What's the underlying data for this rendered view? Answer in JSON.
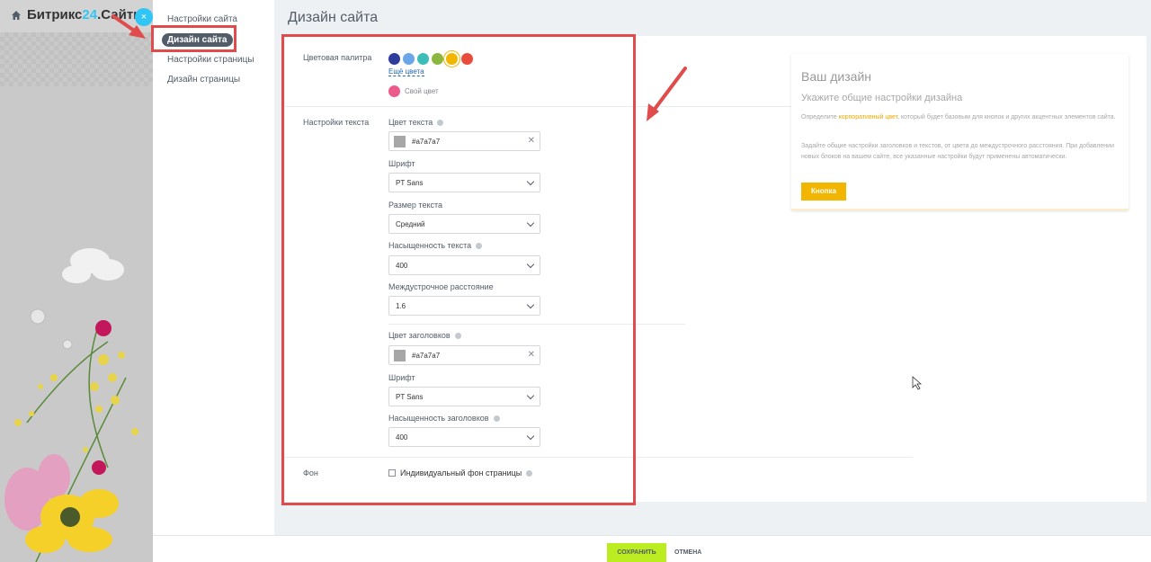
{
  "header": {
    "logo_main": "Битрикс",
    "logo_num": "24",
    "logo_suffix": ".Сайты",
    "close_symbol": "×"
  },
  "nav": {
    "items": [
      {
        "label": "Настройки сайта"
      },
      {
        "label": "Дизайн сайта"
      },
      {
        "label": "Настройки страницы"
      },
      {
        "label": "Дизайн страницы"
      }
    ]
  },
  "page_title": "Дизайн сайта",
  "palette": {
    "label": "Цветовая палитра",
    "colors": [
      "#2e3c9b",
      "#6aa6e8",
      "#3dbdb8",
      "#8bb63f",
      "#f2b600",
      "#e84c3d"
    ],
    "more_label": "Ещё цвета",
    "custom_label": "Свой цвет",
    "custom_color": "#ee5a8c"
  },
  "text_settings": {
    "label": "Настройки текста",
    "text_color_label": "Цвет текста",
    "text_color_value": "#a7a7a7",
    "font_label": "Шрифт",
    "font_value": "PT Sans",
    "size_label": "Размер текста",
    "size_value": "Средний",
    "weight_label": "Насыщенность текста",
    "weight_value": "400",
    "line_height_label": "Междустрочное расстояние",
    "line_height_value": "1.6",
    "heading_color_label": "Цвет заголовков",
    "heading_color_value": "#a7a7a7",
    "heading_font_label": "Шрифт",
    "heading_font_value": "PT Sans",
    "heading_weight_label": "Насыщенность заголовков",
    "heading_weight_value": "400"
  },
  "background": {
    "label": "Фон",
    "checkbox_label": "Индивидуальный фон страницы"
  },
  "preview": {
    "title": "Ваш дизайн",
    "subtitle": "Укажите общие настройки дизайна",
    "p1_before": "Определите ",
    "p1_accent": "корпоративный цвет",
    "p1_after": ", который будет базовым для кнопок и других акцентных элементов сайта.",
    "p2": "Задайте общие настройки заголовков и текстов, от цвета до междустрочного расстояния. При добавлении новых блоков на вашем сайте, все указанные настройки будут применены автоматически.",
    "button": "Кнопка"
  },
  "footer": {
    "save": "СОХРАНИТЬ",
    "cancel": "ОТМЕНА"
  },
  "colors": {
    "accent": "#2fc6f6",
    "save_green": "#bbed21",
    "annotation_red": "#e04b4b",
    "preview_button": "#f2b600"
  }
}
